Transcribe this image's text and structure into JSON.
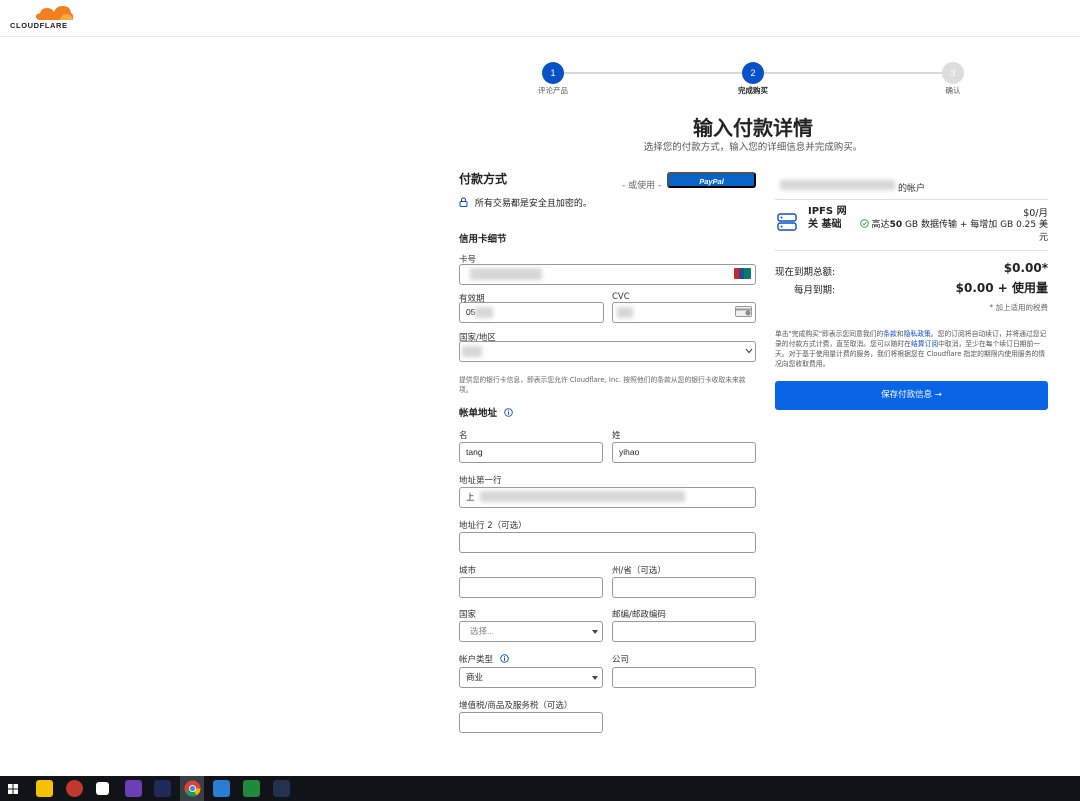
{
  "brand": {
    "name": "CLOUDFLARE",
    "accent": "#0a64e6",
    "cloud_color": "#f38020"
  },
  "stepper": {
    "steps": [
      {
        "number": "1",
        "label": "评论产品",
        "state": "done"
      },
      {
        "number": "2",
        "label": "完成购买",
        "state": "current"
      },
      {
        "number": "3",
        "label": "确认",
        "state": "todo"
      }
    ]
  },
  "page": {
    "title": "输入付款详情",
    "subtitle": "选择您的付款方式，输入您的详细信息并完成购买。"
  },
  "payment": {
    "heading": "付款方式",
    "or_use": "- 或使用 -",
    "paypal_label": "PayPal",
    "secure_note": "所有交易都是安全且加密的。",
    "card_heading": "信用卡细节",
    "card_number_label": "卡号",
    "card_number_value": "",
    "expiry_label": "有效期",
    "expiry_value": "05",
    "cvc_label": "CVC",
    "cvc_value": "",
    "country_label": "国家/地区",
    "country_value": "",
    "authorization_note": "提供您的银行卡信息，即表示您允许 Cloudflare, Inc. 按照他们的条款从您的银行卡收取未来款项。"
  },
  "billing": {
    "heading": "帐单地址",
    "first_name_label": "名",
    "first_name_value": "tang",
    "last_name_label": "姓",
    "last_name_value": "yihao",
    "address1_label": "地址第一行",
    "address1_value": "上",
    "address2_label": "地址行 2（可选）",
    "address2_value": "",
    "city_label": "城市",
    "city_value": "",
    "state_label": "州/省（可选）",
    "state_value": "",
    "country_label": "国家",
    "country_placeholder": "选择...",
    "zip_label": "邮编/邮政编码",
    "zip_value": "",
    "account_type_label": "帐户类型",
    "account_type_value": "商业",
    "company_label": "公司",
    "company_value": "",
    "vat_label": "增值税/商品及服务税（可选）",
    "vat_value": ""
  },
  "summary": {
    "account_suffix": "的帐户",
    "plan_name": "IPFS 网关 基础",
    "plan_price": "$0/月",
    "plan_desc_prefix": "高达",
    "plan_desc_bold": "50",
    "plan_desc_rest": " GB 数据传输 + 每增加 GB 0.25 美元",
    "due_now_label": "现在到期总额:",
    "due_now_value": "$0.00*",
    "monthly_label": "每月到期:",
    "monthly_value": "$0.00 + 使用量",
    "tax_note": "* 加上适用的税费",
    "terms_part1": "单击\"完成购买\"即表示您同意我们的",
    "terms_link1": "条款",
    "terms_and": "和",
    "terms_link2": "隐私政策",
    "terms_part2": "。您的订阅将自动续订，并将通过您记录的付款方式计费，直至取消。您可以随时在",
    "terms_link3": "结算订阅",
    "terms_part3": "中取消，至少在每个续订日期前一天。对于基于使用量计费的服务，我们将根据您在 Cloudflare 指定的期限内使用服务的情况向您收取费用。",
    "save_button": "保存付款信息 →"
  }
}
